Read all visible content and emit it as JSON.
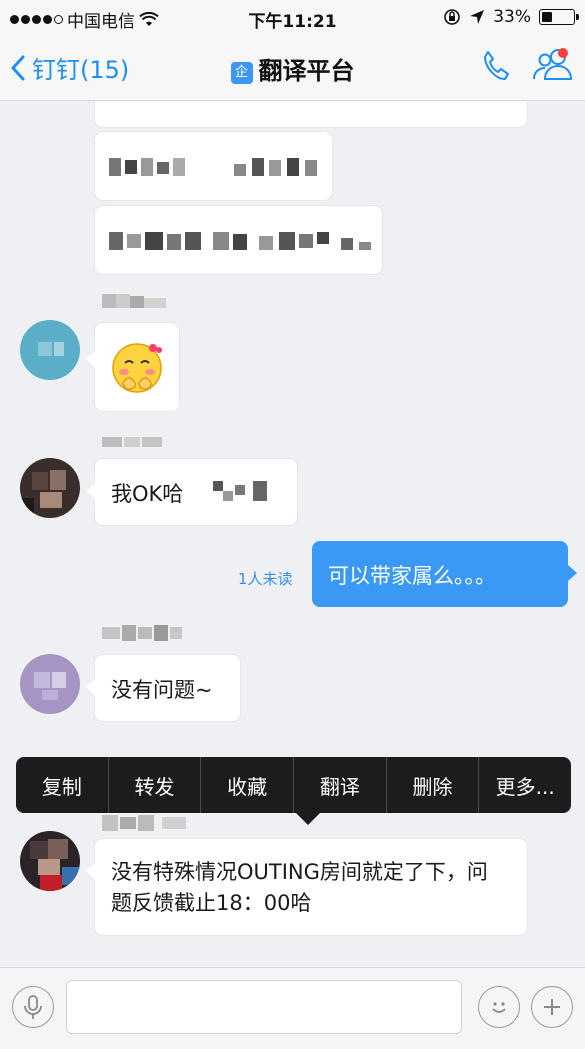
{
  "status_bar": {
    "carrier": "中国电信",
    "time": "下午11:21",
    "battery": "33%",
    "battery_level": 0.33
  },
  "nav": {
    "back_label": "钉钉(15)",
    "title_badge": "企",
    "title": "翻译平台"
  },
  "messages": [
    {
      "type": "text",
      "text": "我OK哈"
    },
    {
      "type": "text",
      "text": "可以带家属么。。。",
      "unread": "1人未读"
    },
    {
      "type": "text",
      "text": "没有问题~"
    },
    {
      "type": "text",
      "text": "没有特殊情况OUTING房间就定了下，问题反馈截止18：00哈"
    }
  ],
  "context_menu": [
    "复制",
    "转发",
    "收藏",
    "翻译",
    "删除",
    "更多..."
  ],
  "input": {
    "placeholder": ""
  },
  "colors": {
    "accent": "#3a99f5",
    "menu": "#1c1c1e",
    "unread": "#3a8fe0"
  }
}
